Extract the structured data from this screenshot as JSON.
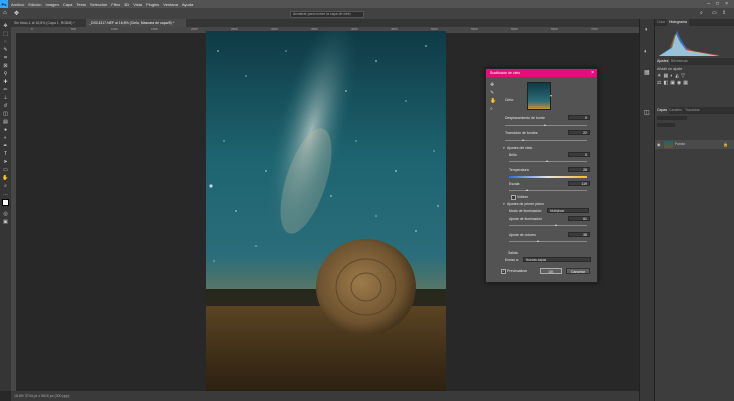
{
  "menubar": {
    "logo": "Ps",
    "items": [
      "Archivo",
      "Edición",
      "Imagen",
      "Capa",
      "Texto",
      "Selección",
      "Filtro",
      "3D",
      "Vista",
      "Plugins",
      "Ventana",
      "Ayuda"
    ]
  },
  "optionsbar": {
    "hint": "Arrastrar para mover la capa de cielo"
  },
  "tabs": [
    {
      "label": "Sin título-1 al 16,8% (Capa 1, RGB/8) *",
      "active": false
    },
    {
      "label": "_DSC4317.NEF al 16,8% (Cielo, Máscara de capa/8) *",
      "active": true
    }
  ],
  "ruler": {
    "top": [
      "0",
      "500",
      "1000",
      "1500",
      "2000",
      "2500",
      "3000",
      "3500",
      "4000",
      "4500",
      "5000",
      "5500",
      "6000",
      "6500",
      "7000"
    ]
  },
  "status": {
    "text": "16,8%   3744 px x 5616 px (300 ppp)"
  },
  "panels": {
    "color_tabs": [
      "Color",
      "Histograma"
    ],
    "adjust_tabs": [
      "Ajustes",
      "Bibliotecas"
    ],
    "adjust_add": "Añadir un ajuste",
    "layers_tabs": [
      "Capas",
      "Canales",
      "Trazados"
    ],
    "layer_name": "Fondo"
  },
  "dialog": {
    "title": "Sustitución de cielo",
    "sky_label": "Cielo:",
    "shift_edge": {
      "label": "Desplazamiento de borde",
      "value": "0"
    },
    "fade_edge": {
      "label": "Transición de bordes",
      "value": "22"
    },
    "sky_adjust": "Ajustes del cielo",
    "brightness": {
      "label": "Brillo",
      "value": "0"
    },
    "temperature": {
      "label": "Temperatura",
      "value": "28"
    },
    "scale": {
      "label": "Escala",
      "value": "119"
    },
    "flip": "Voltear",
    "fg_adjust": "Ajustes de primer plano",
    "lighting_mode": {
      "label": "Modo de iluminación:",
      "value": "Multiplicar"
    },
    "lighting_adjust": {
      "label": "Ajuste de iluminación",
      "value": "61"
    },
    "color_adjust": {
      "label": "Ajuste de colores",
      "value": "38"
    },
    "output": "Salida",
    "output_to": {
      "label": "Enviar a:",
      "value": "Nuevas capas"
    },
    "preview": "Previsualizar",
    "ok": "OK",
    "cancel": "Cancelar"
  }
}
